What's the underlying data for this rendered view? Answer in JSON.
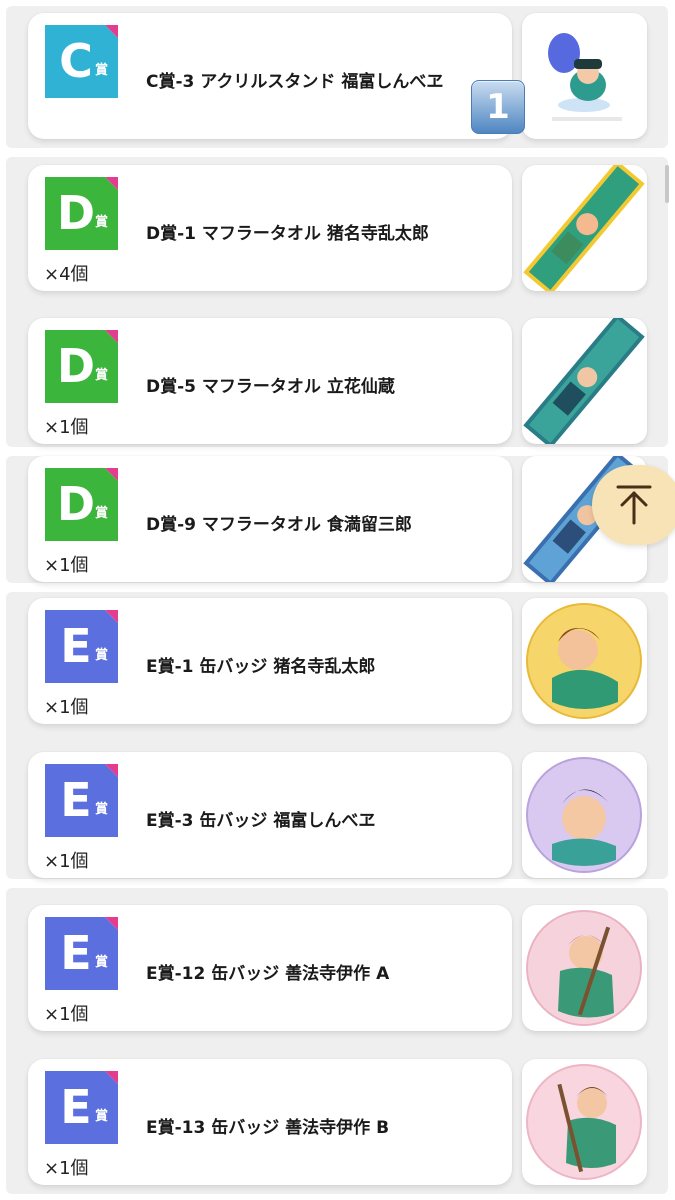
{
  "badges": {
    "prize_char": "賞",
    "colors": {
      "C": "#2fb2d4",
      "D": "#3cb53c",
      "E": "#5b6fde",
      "corner": "#e33d8f"
    }
  },
  "items": [
    {
      "grade": "C",
      "title": "C賞-3 アクリルスタンド 福富しんべヱ",
      "quantity": "",
      "thumbnail": "acrylic-stand-image"
    },
    {
      "grade": "D",
      "title": "D賞-1 マフラータオル 猪名寺乱太郎",
      "quantity": "×4個",
      "thumbnail": "muffler-towel-image"
    },
    {
      "grade": "D",
      "title": "D賞-5 マフラータオル 立花仙蔵",
      "quantity": "×1個",
      "thumbnail": "muffler-towel-image"
    },
    {
      "grade": "D",
      "title": "D賞-9 マフラータオル 食満留三郎",
      "quantity": "×1個",
      "thumbnail": "muffler-towel-image"
    },
    {
      "grade": "E",
      "title": "E賞-1 缶バッジ 猪名寺乱太郎",
      "quantity": "×1個",
      "thumbnail": "can-badge-image"
    },
    {
      "grade": "E",
      "title": "E賞-3 缶バッジ 福富しんべヱ",
      "quantity": "×1個",
      "thumbnail": "can-badge-image"
    },
    {
      "grade": "E",
      "title": "E賞-12 缶バッジ 善法寺伊作 A",
      "quantity": "×1個",
      "thumbnail": "can-badge-image"
    },
    {
      "grade": "E",
      "title": "E賞-13 缶バッジ 善法寺伊作 B",
      "quantity": "×1個",
      "thumbnail": "can-badge-image"
    }
  ],
  "overlay": {
    "number_marker": "1",
    "scroll_top_icon": "arrow-up-to-top-icon",
    "scroll_top_color": "#f7e3b5"
  }
}
